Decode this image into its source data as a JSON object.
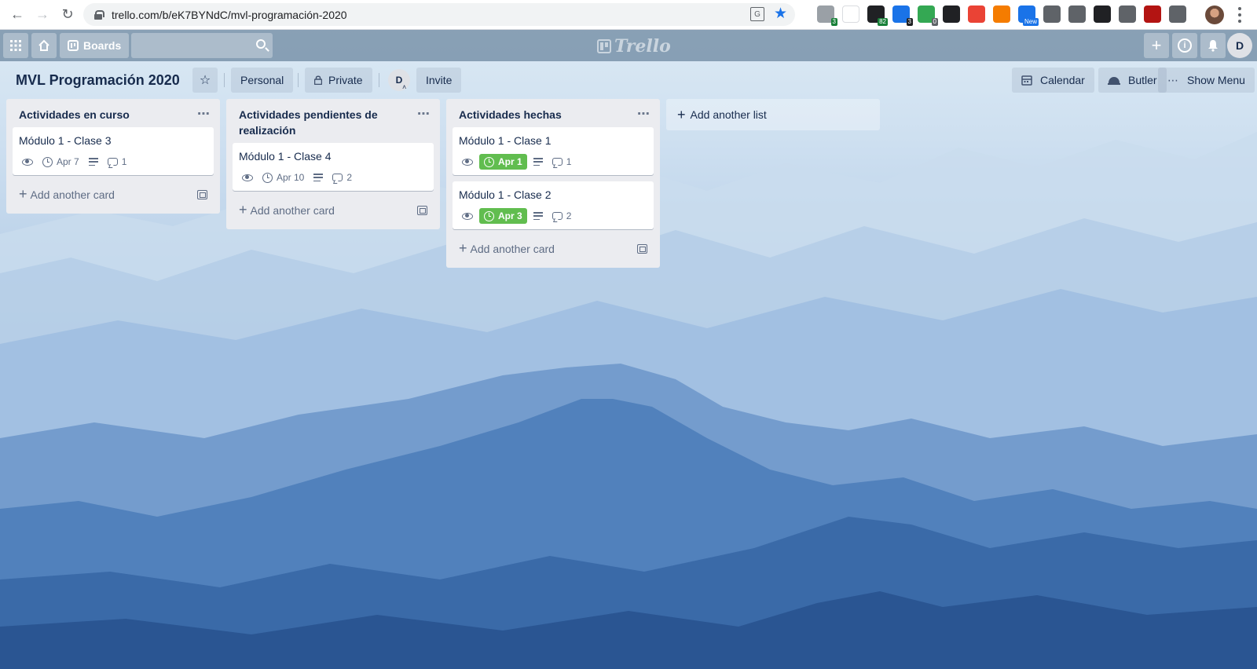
{
  "browser": {
    "url": "trello.com/b/eK7BYNdC/mvl-programación-2020",
    "extensions": [
      {
        "name": "ext-1",
        "color": "#9aa0a6",
        "badge": "3",
        "badge_color": "#188038"
      },
      {
        "name": "ext-2",
        "color": "#ffffff",
        "badge": "",
        "badge_color": ""
      },
      {
        "name": "ext-3",
        "color": "#202124",
        "badge": "82",
        "badge_color": "#188038"
      },
      {
        "name": "ext-4",
        "color": "#1a73e8",
        "badge": "3",
        "badge_color": "#202124"
      },
      {
        "name": "ext-5",
        "color": "#34a853",
        "badge": "0",
        "badge_color": "#5f6368"
      },
      {
        "name": "ext-6",
        "color": "#202124",
        "badge": "",
        "badge_color": ""
      },
      {
        "name": "ext-7",
        "color": "#ea4335",
        "badge": "",
        "badge_color": ""
      },
      {
        "name": "ext-8",
        "color": "#f57c00",
        "badge": "",
        "badge_color": ""
      },
      {
        "name": "ext-9",
        "color": "#1a73e8",
        "badge": "New",
        "badge_color": "#1a73e8"
      },
      {
        "name": "ext-10",
        "color": "#5f6368",
        "badge": "",
        "badge_color": ""
      },
      {
        "name": "ext-11",
        "color": "#5f6368",
        "badge": "",
        "badge_color": ""
      },
      {
        "name": "ext-12",
        "color": "#202124",
        "badge": "",
        "badge_color": ""
      },
      {
        "name": "ext-13",
        "color": "#5f6368",
        "badge": "",
        "badge_color": ""
      },
      {
        "name": "ext-14",
        "color": "#b31412",
        "badge": "",
        "badge_color": ""
      },
      {
        "name": "ext-15",
        "color": "#5f6368",
        "badge": "",
        "badge_color": ""
      }
    ]
  },
  "header": {
    "boards_label": "Boards",
    "logo_text": "Trello",
    "user_initial": "D"
  },
  "board": {
    "title": "MVL Programación 2020",
    "team_label": "Personal",
    "visibility_label": "Private",
    "member_initial": "D",
    "invite_label": "Invite",
    "calendar_label": "Calendar",
    "butler_label": "Butler",
    "show_menu_label": "Show Menu"
  },
  "lists": [
    {
      "title": "Actividades en curso",
      "add_card_label": "Add another card",
      "cards": [
        {
          "title": "Módulo 1 - Clase 3",
          "due": "Apr 7",
          "due_done": false,
          "comments": "1"
        }
      ]
    },
    {
      "title": "Actividades pendientes de realización",
      "add_card_label": "Add another card",
      "cards": [
        {
          "title": "Módulo 1 - Clase 4",
          "due": "Apr 10",
          "due_done": false,
          "comments": "2"
        }
      ]
    },
    {
      "title": "Actividades hechas",
      "add_card_label": "Add another card",
      "cards": [
        {
          "title": "Módulo 1 - Clase 1",
          "due": "Apr 1",
          "due_done": true,
          "comments": "1"
        },
        {
          "title": "Módulo 1 - Clase 2",
          "due": "Apr 3",
          "due_done": true,
          "comments": "2"
        }
      ]
    }
  ],
  "add_list_label": "Add another list",
  "colors": {
    "due_done": "#61bd4f",
    "list_bg": "#ebecf0",
    "title_text": "#172b4d"
  }
}
